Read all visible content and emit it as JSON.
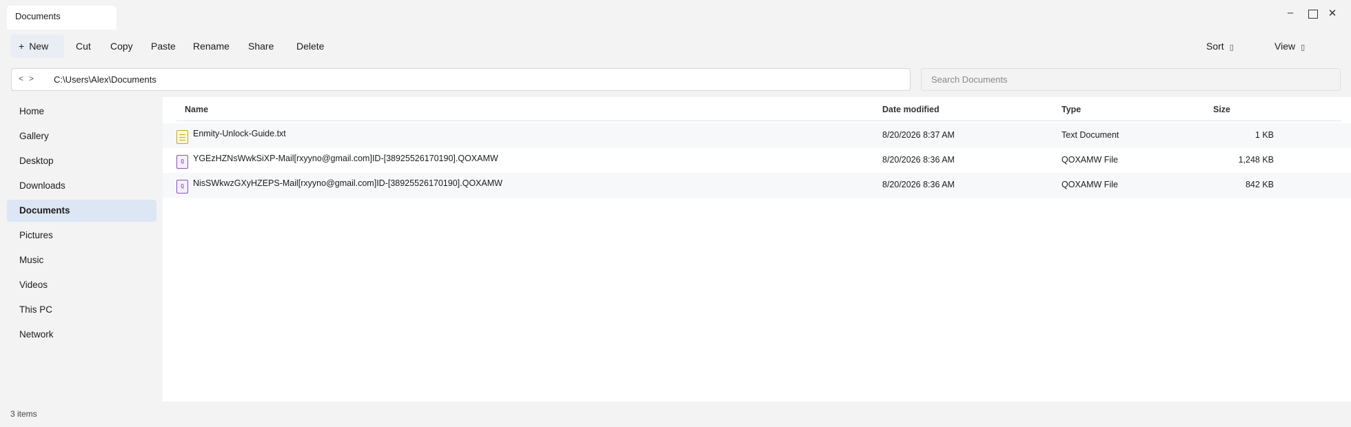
{
  "window": {
    "tab_title": "Documents",
    "controls": {
      "minimize": "–",
      "close": "✕"
    }
  },
  "toolbar": {
    "new_label": "New",
    "new_icon": "+",
    "cut_label": "Cut",
    "copy_label": "Copy",
    "paste_label": "Paste",
    "rename_label": "Rename",
    "share_label": "Share",
    "delete_label": "Delete",
    "sort_label": "Sort",
    "view_label": "View",
    "dropdown_glyph": "▯"
  },
  "address": {
    "back": "<",
    "forward": ">",
    "path": "C:\\Users\\Alex\\Documents"
  },
  "search": {
    "placeholder": "Search Documents",
    "value": ""
  },
  "sidebar": {
    "items": [
      {
        "label": "Home"
      },
      {
        "label": "Gallery"
      },
      {
        "label": "Desktop"
      },
      {
        "label": "Downloads"
      },
      {
        "label": "Documents"
      },
      {
        "label": "Pictures"
      },
      {
        "label": "Music"
      },
      {
        "label": "Videos"
      },
      {
        "label": "This PC"
      },
      {
        "label": "Network"
      }
    ],
    "active": "Documents"
  },
  "file_list": {
    "columns": {
      "name": "Name",
      "date": "Date modified",
      "type": "Type",
      "size": "Size"
    },
    "files": [
      {
        "name": "Enmity-Unlock-Guide.txt",
        "date": "8/20/2026 8:37 AM",
        "type": "Text Document",
        "size": "1 KB",
        "icon": "text-file-icon"
      },
      {
        "name": "YGEzHZNsWwkSiXP-Mail[rxyyno@gmail.com]ID-[38925526170190].QOXAMW",
        "date": "8/20/2026 8:36 AM",
        "type": "QOXAMW File",
        "size": "1,248 KB",
        "icon": "qoxamw-file-icon",
        "icon_glyph": "Q"
      },
      {
        "name": "NisSWkwzGXyHZEPS-Mail[rxyyno@gmail.com]ID-[38925526170190].QOXAMW",
        "date": "8/20/2026 8:36 AM",
        "type": "QOXAMW File",
        "size": "842 KB",
        "icon": "qoxamw-file-icon",
        "icon_glyph": "Q"
      }
    ]
  },
  "status": {
    "item_count": "3 items"
  },
  "colors": {
    "accent": "#dce6f4",
    "text_file_icon": "#c9a227",
    "qoxamw_file_icon": "#8a4fc0"
  }
}
